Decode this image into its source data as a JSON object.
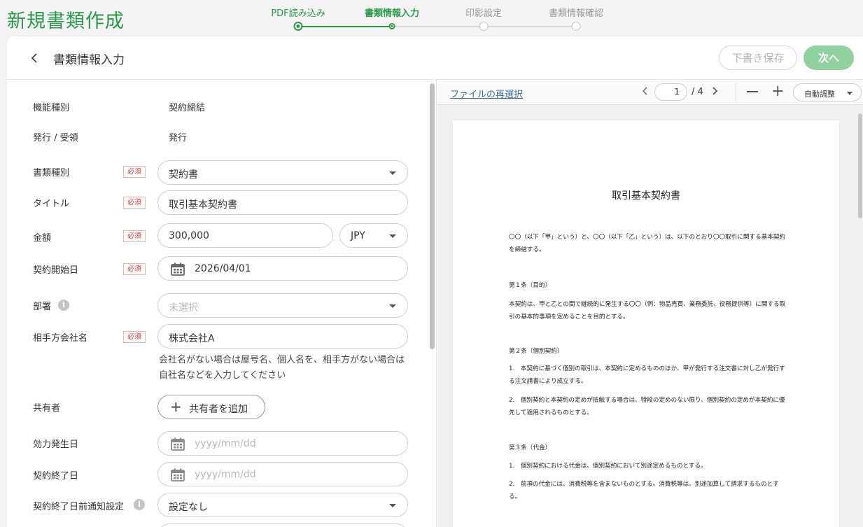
{
  "app": {
    "title": "新規書類作成"
  },
  "stepper": {
    "steps": [
      {
        "label": "PDF読み込み",
        "state": "done"
      },
      {
        "label": "書類情報入力",
        "state": "active"
      },
      {
        "label": "印影設定",
        "state": "todo"
      },
      {
        "label": "書類情報確認",
        "state": "todo"
      }
    ]
  },
  "header": {
    "title": "書類情報入力",
    "draft_label": "下書き保存",
    "next_label": "次へ"
  },
  "form": {
    "function_type": {
      "label": "機能種別",
      "value": "契約締結"
    },
    "issue_receive": {
      "label": "発行 / 受領",
      "value": "発行"
    },
    "required_badge": "必須",
    "document_type": {
      "label": "書類種別",
      "value": "契約書"
    },
    "title": {
      "label": "タイトル",
      "value": "取引基本契約書"
    },
    "amount": {
      "label": "金額",
      "value": "300,000",
      "currency": "JPY"
    },
    "contract_start": {
      "label": "契約開始日",
      "value": "2026/04/01"
    },
    "department": {
      "label": "部署",
      "placeholder": "未選択"
    },
    "counterparty": {
      "label": "相手方会社名",
      "value": "株式会社A",
      "help": "会社名がない場合は屋号名、個人名を、相手方がない場合は自社名などを入力してください"
    },
    "sharer": {
      "label": "共有者",
      "button": "共有者を追加"
    },
    "effective_date": {
      "label": "効力発生日",
      "placeholder": "yyyy/mm/dd"
    },
    "contract_end": {
      "label": "契約終了日",
      "placeholder": "yyyy/mm/dd"
    },
    "end_notice": {
      "label": "契約終了日前通知設定",
      "value": "設定なし"
    }
  },
  "viewer": {
    "reselect": "ファイルの再選択",
    "page": "1",
    "page_total": "/ 4",
    "zoom": "自動調整"
  },
  "document": {
    "title": "取引基本契約書",
    "paragraphs": [
      "〇〇（以下「甲」という）と、〇〇（以下「乙」という）は、以下のとおり〇〇取引に関する基本契約を締結する。",
      "第１条（目的）",
      "本契約は、甲と乙との間で継続的に発生する〇〇（例：物品売買、業務委託、役務提供等）に関する取引の基本的事項を定めることを目的とする。",
      "第２条（個別契約）",
      "1.　本契約に基づく個別の取引は、本契約に定めるもののほか、甲が発行する注文書に対し乙が発行する注文請書により成立する。",
      "2.　個別契約と本契約の定めが抵触する場合は、特段の定めのない限り、個別契約の定めが本契約に優先して適用されるものとする。",
      "第３条（代金）",
      "1.　個別契約における代金は、個別契約において別途定めるものとする。",
      "2.　前項の代金には、消費税等を含まないものとする。消費税等は、別途加算して請求するものとする。"
    ]
  },
  "colors": {
    "brand": "#2a9a4a",
    "next_button": "#90d1a0",
    "required": "#e03a3a",
    "link": "#3a6e9a"
  }
}
